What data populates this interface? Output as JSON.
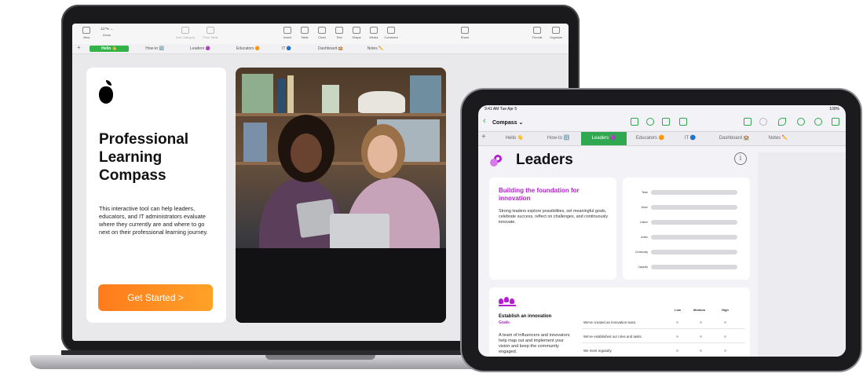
{
  "laptop": {
    "toolbar": {
      "left": [
        {
          "icon": "view-icon",
          "label": "View"
        },
        {
          "icon": "zoom-icon",
          "label": "Zoom"
        }
      ],
      "zoom_value": "117% ⌄",
      "middle": [
        {
          "icon": "add-category-icon",
          "label": "Add Category"
        },
        {
          "icon": "pivot-table-icon",
          "label": "Pivot Table"
        }
      ],
      "insert_group": [
        {
          "icon": "insert-icon",
          "label": "Insert"
        },
        {
          "icon": "table-icon",
          "label": "Table"
        },
        {
          "icon": "chart-icon",
          "label": "Chart"
        },
        {
          "icon": "text-icon",
          "label": "Text"
        },
        {
          "icon": "shape-icon",
          "label": "Shape"
        },
        {
          "icon": "media-icon",
          "label": "Media"
        },
        {
          "icon": "comment-icon",
          "label": "Comment"
        }
      ],
      "share": {
        "icon": "share-icon",
        "label": "Share"
      },
      "right": [
        {
          "icon": "format-icon",
          "label": "Format"
        },
        {
          "icon": "organize-icon",
          "label": "Organize"
        }
      ]
    },
    "tabs": [
      {
        "label": "Hello 👋",
        "active": true
      },
      {
        "label": "How-to 🔢",
        "active": false
      },
      {
        "label": "Leaders 🟣",
        "active": false
      },
      {
        "label": "Educators 🟠",
        "active": false
      },
      {
        "label": "IT 🔵",
        "active": false
      },
      {
        "label": "Dashboard 🏫",
        "active": false
      },
      {
        "label": "Notes ✏️",
        "active": false
      }
    ],
    "card": {
      "title": "Professional Learning Compass",
      "description": "This interactive tool can help leaders, educators, and IT administrators evaluate where they currently are and where to go next on their professional learning journey.",
      "button": "Get Started >"
    },
    "colors": {
      "accent_green": "#33b24a",
      "button_orange": "#ff8a20"
    }
  },
  "ipad": {
    "status": {
      "time": "9:41 AM  Tue Apr 5",
      "battery": "100%"
    },
    "document": {
      "name": "Compass ⌄"
    },
    "tabs": [
      {
        "label": "Hello 👋",
        "active": false
      },
      {
        "label": "How-to 🔢",
        "active": false
      },
      {
        "label": "Leaders 🟣",
        "active": true
      },
      {
        "label": "Educators 🟠",
        "active": false
      },
      {
        "label": "IT 🔵",
        "active": false
      },
      {
        "label": "Dashboard 🏫",
        "active": false
      },
      {
        "label": "Notes ✏️",
        "active": false
      }
    ],
    "page_title": "Leaders",
    "foundation_card": {
      "heading": "Building the foundation for innovation",
      "body": "Strong leaders explore possibilities, set meaningful goals, celebrate success, reflect on challenges, and continuously innovate."
    },
    "bars": [
      {
        "label": "Team",
        "value": 1
      },
      {
        "label": "Vision",
        "value": 1
      },
      {
        "label": "Culture",
        "value": 1
      },
      {
        "label": "Action",
        "value": 1
      },
      {
        "label": "Community",
        "value": 1
      },
      {
        "label": "Capacity",
        "value": 1
      }
    ],
    "innovation_card": {
      "heading": "Establish an innovation",
      "subheading": "Goals",
      "body": "A team of influencers and innovators help map out and implement your vision and keep the community engaged.",
      "columns": [
        "Low",
        "Medium",
        "High"
      ],
      "rows": [
        "We've created an innovation team.",
        "We've established our roles and tasks.",
        "We meet regularly."
      ]
    },
    "colors": {
      "accent_green": "#2fa84f",
      "leaders_purple": "#b51dd3"
    }
  }
}
